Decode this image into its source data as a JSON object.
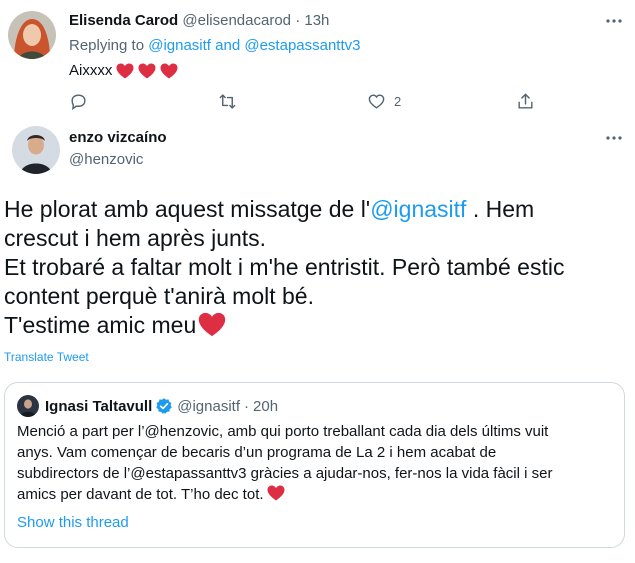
{
  "tweet_reply": {
    "author_name": "Elisenda Carod",
    "handle": "@elisendacarod",
    "separator": "·",
    "time": "13h",
    "replying_prefix": "Replying to",
    "replying_to_1": "@ignasitf",
    "replying_and": "and",
    "replying_to_2": "@estapassanttv3",
    "text": "Aixxxx",
    "likes": "2"
  },
  "tweet_main": {
    "author_name": "enzo vizcaíno",
    "handle": "@henzovic",
    "text_line1_a": "He plorat amb aquest missatge de l'",
    "text_line1_mention": "@ignasitf",
    "text_line1_b": " . Hem",
    "text_line2": "crescut i hem après junts.",
    "text_line3": "Et trobaré a faltar molt i m'he entristit. Però també estic",
    "text_line4": "content perquè t'anirà molt bé.",
    "text_line5": "T'estime amic meu",
    "translate_label": "Translate Tweet"
  },
  "quoted_tweet": {
    "author_name": "Ignasi Taltavull",
    "handle": "@ignasitf",
    "separator": "·",
    "time": "20h",
    "line1": "Menció a part per l’@henzovic, amb qui porto treballant cada dia dels últims vuit",
    "line2": "anys. Vam començar de becaris d’un programa de La 2 i hem acabat de",
    "line3": "subdirectors de l’@estapassanttv3 gràcies a ajudar-nos, fer-nos la vida fàcil i ser",
    "line4": "amics per davant de tot. T’ho dec tot.",
    "show_thread": "Show this thread"
  },
  "icons": [
    "more-icon",
    "reply-icon",
    "retweet-icon",
    "like-icon",
    "share-icon",
    "verified-icon",
    "heart-emoji"
  ],
  "colors": {
    "accent": "#1d9bf0",
    "muted": "#536471",
    "heart": "#dd2e44",
    "border": "#cfd9de"
  }
}
